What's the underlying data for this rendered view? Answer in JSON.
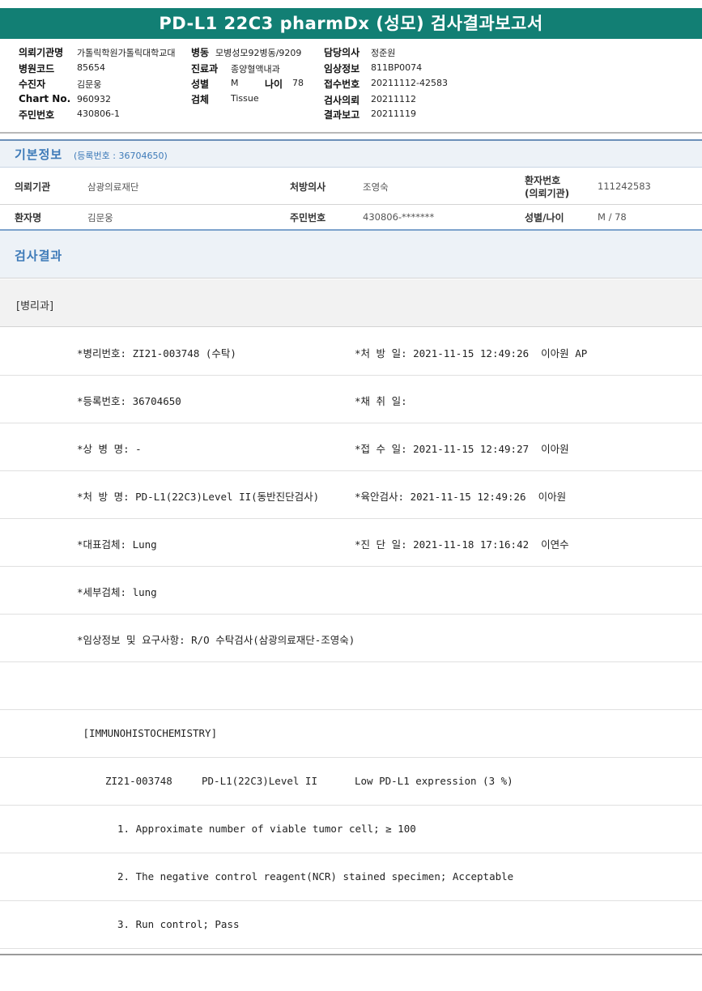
{
  "title": "PD-L1 22C3 pharmDx (성모) 검사결과보고서",
  "header": {
    "fields": [
      {
        "label": "의뢰기관명",
        "value": "가톨릭학원가톨릭대학교대"
      },
      {
        "label": "병원코드",
        "value": "85654"
      },
      {
        "label": "수진자",
        "value": "김문웅"
      },
      {
        "label": "Chart No.",
        "value": "960932"
      },
      {
        "label": "주민번호",
        "value": "430806-1"
      },
      {
        "label": "병동",
        "value": "모병성모92병동/9209"
      },
      {
        "label": "진료과",
        "value": "종양혈액내과"
      },
      {
        "label": "성별",
        "value": "M"
      },
      {
        "label": "나이",
        "value": "78"
      },
      {
        "label": "검체",
        "value": "Tissue"
      },
      {
        "label": "담당의사",
        "value": "정준원"
      },
      {
        "label": "임상정보",
        "value": "811BP0074"
      },
      {
        "label": "접수번호",
        "value": "20211112-42583"
      },
      {
        "label": "검사의뢰",
        "value": "20211112"
      },
      {
        "label": "결과보고",
        "value": "20211119"
      }
    ]
  },
  "basic_info": {
    "title": "기본정보",
    "subtitle": "(등록번호 : 36704650)",
    "rows": [
      [
        {
          "label": "의뢰기관",
          "value": "삼광의료재단"
        },
        {
          "label": "처방의사",
          "value": "조영숙"
        },
        {
          "label": "환자번호",
          "label2": "(의뢰기관)",
          "value": "111242583"
        }
      ],
      [
        {
          "label": "환자명",
          "value": "김문웅"
        },
        {
          "label": "주민번호",
          "value": "430806-*******"
        },
        {
          "label": "성별/나이",
          "value": "M / 78"
        }
      ]
    ]
  },
  "result": {
    "title": "검사결과",
    "dept": "[병리과]",
    "lines": [
      {
        "c1": "*병리번호: ZI21-003748 (수탁)",
        "c2": "*처 방 일: 2021-11-15 12:49:26  이아원 AP"
      },
      {
        "c1": "*등록번호: 36704650",
        "c2": "*채 취 일:"
      },
      {
        "c1": "*상 병 명: -",
        "c2": "*접 수 일: 2021-11-15 12:49:27  이아원"
      },
      {
        "c1": "*처 방 명: PD-L1(22C3)Level II(동반진단검사)",
        "c2": "*육안검사: 2021-11-15 12:49:26  이아원"
      },
      {
        "c1": "*대표검체: Lung",
        "c2": "*진 단 일: 2021-11-18 17:16:42  이연수"
      },
      {
        "c1": "*세부검체: lung",
        "c2": ""
      },
      {
        "c1": "*임상정보 및 요구사항: R/O 수탁검사(삼광의료재단-조영숙)",
        "c2": ""
      },
      {
        "c1": "",
        "c2": ""
      },
      {
        "c1": " [IMMUNOHISTOCHEMISTRY]",
        "c2": ""
      }
    ],
    "ihc": {
      "case_no": "ZI21-003748",
      "test": "PD-L1(22C3)Level II",
      "result": "Low PD-L1 expression (3 %)"
    },
    "notes": [
      "1. Approximate number of viable tumor cell; ≥ 100",
      "2. The negative control reagent(NCR) stained specimen; Acceptable",
      "3. Run control; Pass"
    ]
  }
}
